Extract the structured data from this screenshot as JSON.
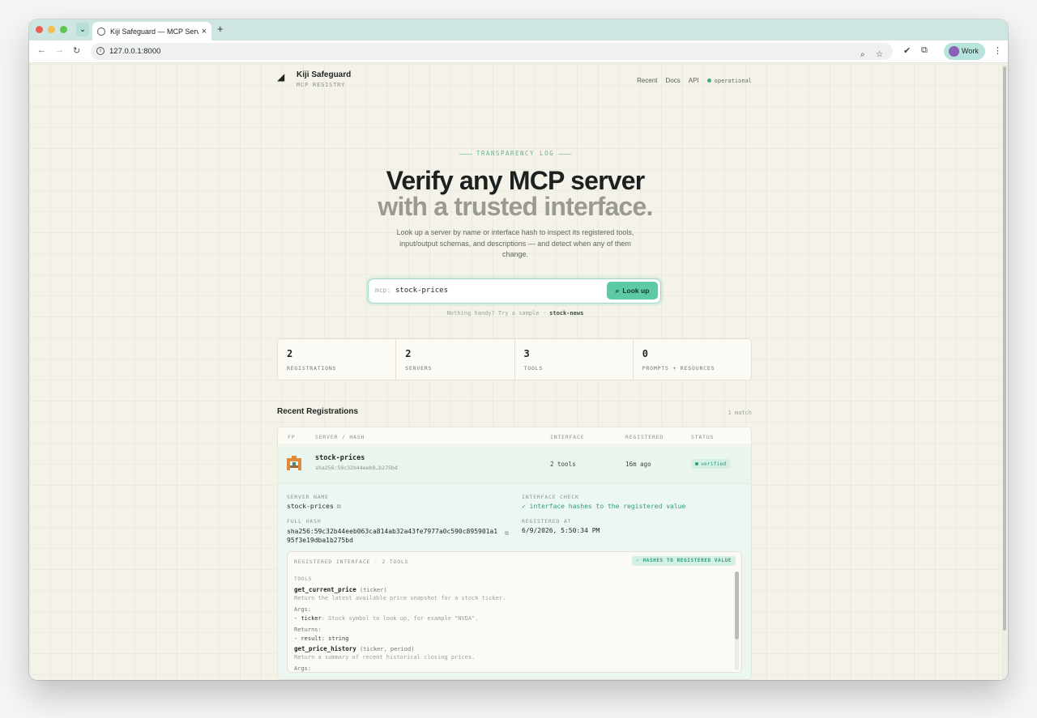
{
  "browser": {
    "tab_title": "Kiji Safeguard — MCP Server",
    "url": "127.0.0.1:8000",
    "profile": "Work"
  },
  "site": {
    "brand_name": "Kiji Safeguard",
    "brand_sub": "MCP REGISTRY",
    "nav": [
      "Recent",
      "Docs",
      "API"
    ],
    "status": "operational"
  },
  "hero": {
    "eyebrow": "TRANSPARENCY LOG",
    "title_line1": "Verify any MCP server",
    "title_line2": "with a trusted interface.",
    "description": "Look up a server by name or interface hash to inspect its registered tools, input/output schemas, and descriptions — and detect when any of them change."
  },
  "search": {
    "prefix": "mcp:",
    "value": "stock-prices",
    "button": "Look up",
    "hint_text": "Nothing handy? Try a sample ·",
    "hint_sample": "stock-news"
  },
  "stats": [
    {
      "value": "2",
      "label": "REGISTRATIONS"
    },
    {
      "value": "2",
      "label": "SERVERS"
    },
    {
      "value": "3",
      "label": "TOOLS"
    },
    {
      "value": "0",
      "label": "PROMPTS + RESOURCES"
    }
  ],
  "recent": {
    "title": "Recent Registrations",
    "count": "1 match",
    "columns": [
      "FP",
      "SERVER / HASH",
      "INTERFACE",
      "REGISTERED",
      "STATUS"
    ],
    "rows": [
      {
        "name": "stock-prices",
        "hash": "sha256:59c32b44eeb0…b275bd",
        "interface": "2 tools",
        "registered": "16m ago",
        "status": "verified"
      }
    ]
  },
  "detail": {
    "server_name_label": "SERVER NAME",
    "server_name": "stock-prices",
    "check_label": "INTERFACE CHECK",
    "check_value": "✓ interface hashes to the registered value",
    "full_hash_label": "FULL HASH",
    "full_hash": "sha256:59c32b44eeb063ca814ab32a43fe7977a0c590c895901a195f3e19dba1b275bd",
    "registered_at_label": "REGISTERED AT",
    "registered_at": "6/9/2026, 5:50:34 PM",
    "interface_header": "REGISTERED INTERFACE · 2 TOOLS",
    "interface_badge": "✓ HASHES TO REGISTERED VALUE",
    "tools_label": "TOOLS",
    "tools": [
      {
        "name": "get_current_price",
        "params": "(ticker)",
        "description": "Return the latest available price snapshot for a stock ticker.",
        "args_label": "Args:",
        "arg_key": "ticker",
        "arg_desc": ": Stock symbol to look up, for example \"NVDA\".",
        "returns_label": "Returns:",
        "returns": "- result: string"
      },
      {
        "name": "get_price_history",
        "params": "(ticker, period)",
        "description": "Return a summary of recent historical closing prices.",
        "args_label": "Args:"
      }
    ]
  }
}
